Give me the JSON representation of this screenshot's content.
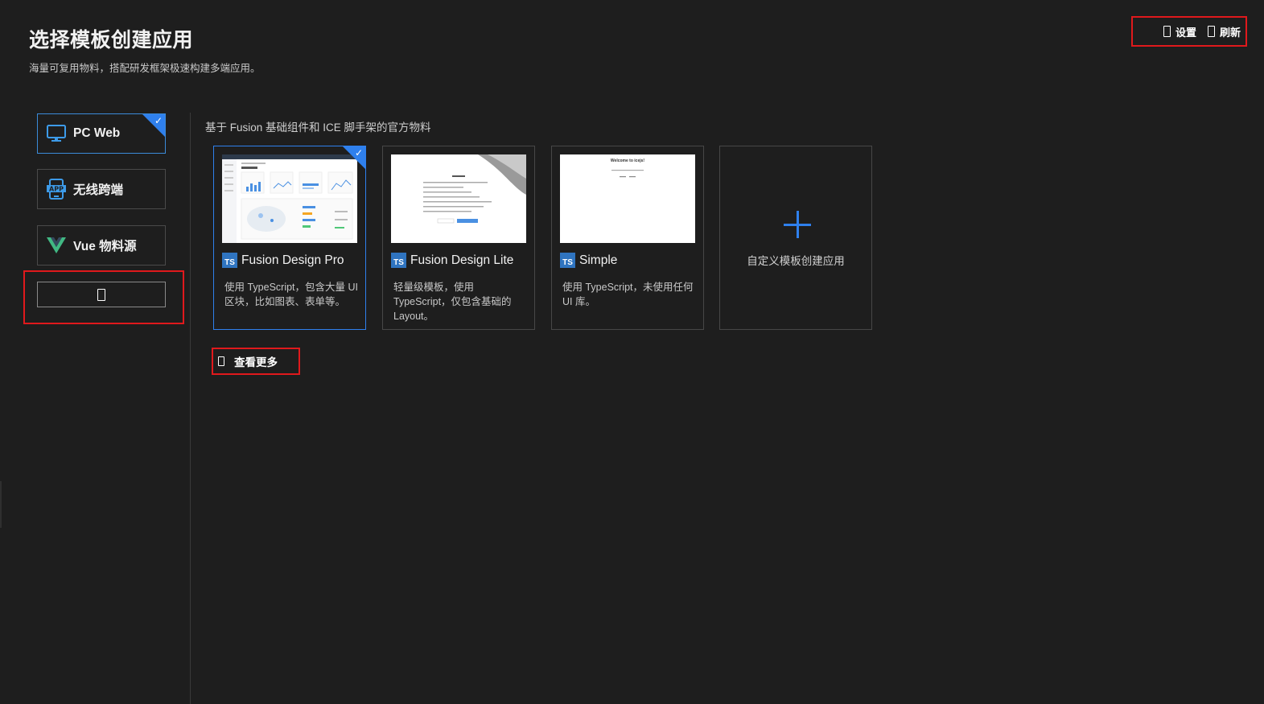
{
  "header": {
    "title": "选择模板创建应用",
    "subtitle": "海量可复用物料，搭配研发框架极速构建多端应用。"
  },
  "top_actions": {
    "settings_label": "设置",
    "refresh_label": "刷新"
  },
  "sidebar": {
    "items": [
      {
        "label": "PC Web",
        "icon": "monitor-icon",
        "selected": true
      },
      {
        "label": "无线跨端",
        "icon": "app-phone-icon",
        "selected": false
      },
      {
        "label": "Vue 物料源",
        "icon": "vue-logo-icon",
        "selected": false
      }
    ],
    "add_button_icon": "placeholder-box-icon"
  },
  "main": {
    "section_label": "基于 Fusion 基础组件和 ICE 脚手架的官方物料",
    "cards": [
      {
        "name": "Fusion Design Pro",
        "badge": "TS",
        "description": "使用 TypeScript，包含大量 UI 区块，比如图表、表单等。",
        "selected": true
      },
      {
        "name": "Fusion Design Lite",
        "badge": "TS",
        "description": "轻量级模板，使用 TypeScript，仅包含基础的 Layout。",
        "selected": false
      },
      {
        "name": "Simple",
        "badge": "TS",
        "description": "使用 TypeScript，未使用任何 UI 库。",
        "selected": false
      }
    ],
    "custom_card_label": "自定义模板创建应用",
    "more_label": "查看更多",
    "thumb_text": {
      "simple_title": "Welcome to icejs!"
    }
  },
  "colors": {
    "background": "#1e1e1e",
    "accent_blue": "#2f80ed",
    "highlight_red": "#e0191c",
    "ts_badge": "#2f74c0",
    "vue_green": "#41b883"
  }
}
